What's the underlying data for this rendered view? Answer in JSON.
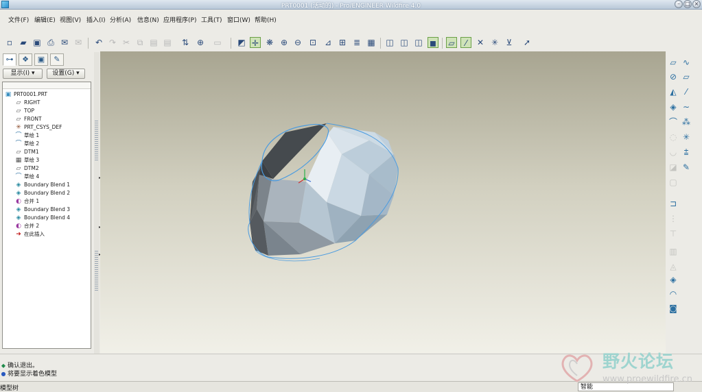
{
  "window": {
    "title": "PRT0001 (活动的) - Pro/ENGINEER Wildfire 4.0"
  },
  "menu": [
    {
      "label": "文件(F)"
    },
    {
      "label": "编辑(E)"
    },
    {
      "label": "视图(V)"
    },
    {
      "label": "插入(I)"
    },
    {
      "label": "分析(A)"
    },
    {
      "label": "信息(N)"
    },
    {
      "label": "应用程序(P)"
    },
    {
      "label": "工具(T)"
    },
    {
      "label": "窗口(W)"
    },
    {
      "label": "帮助(H)"
    }
  ],
  "navigator": {
    "show_button": "显示(I) ▾",
    "settings_button": "设置(G) ▾"
  },
  "model_tree": {
    "root": "PRT0001.PRT",
    "items": [
      {
        "label": "RIGHT",
        "icon": "datum-plane-icon"
      },
      {
        "label": "TOP",
        "icon": "datum-plane-icon"
      },
      {
        "label": "FRONT",
        "icon": "datum-plane-icon"
      },
      {
        "label": "PRT_CSYS_DEF",
        "icon": "csys-icon"
      },
      {
        "label": "草绘 1",
        "icon": "sketch-icon"
      },
      {
        "label": "草绘 2",
        "icon": "sketch-icon"
      },
      {
        "label": "DTM1",
        "icon": "datum-plane-icon"
      },
      {
        "label": "草绘 3",
        "icon": "sketch-icon"
      },
      {
        "label": "DTM2",
        "icon": "datum-plane-icon"
      },
      {
        "label": "草绘 4",
        "icon": "sketch-icon"
      },
      {
        "label": "Boundary Blend 1",
        "icon": "boundary-blend-icon"
      },
      {
        "label": "Boundary Blend 2",
        "icon": "boundary-blend-icon"
      },
      {
        "label": "合并 1",
        "icon": "merge-icon"
      },
      {
        "label": "Boundary Blend 3",
        "icon": "boundary-blend-icon"
      },
      {
        "label": "Boundary Blend 4",
        "icon": "boundary-blend-icon"
      },
      {
        "label": "合并 2",
        "icon": "merge-icon"
      },
      {
        "label": "在此插入",
        "icon": "insert-here-icon"
      }
    ]
  },
  "messages": [
    {
      "text": "确认退出。",
      "icon": "success-icon"
    },
    {
      "text": "将要显示着色模型",
      "icon": "info-icon"
    }
  ],
  "status": {
    "mode": "模型树",
    "filter_value": "智能"
  },
  "watermark": {
    "title": "野火论坛",
    "url": "www.proewildfire.cn"
  },
  "colors": {
    "model_light": "#c9d7e2",
    "model_dark": "#4d5256",
    "edge_highlight": "#4a9be0"
  }
}
